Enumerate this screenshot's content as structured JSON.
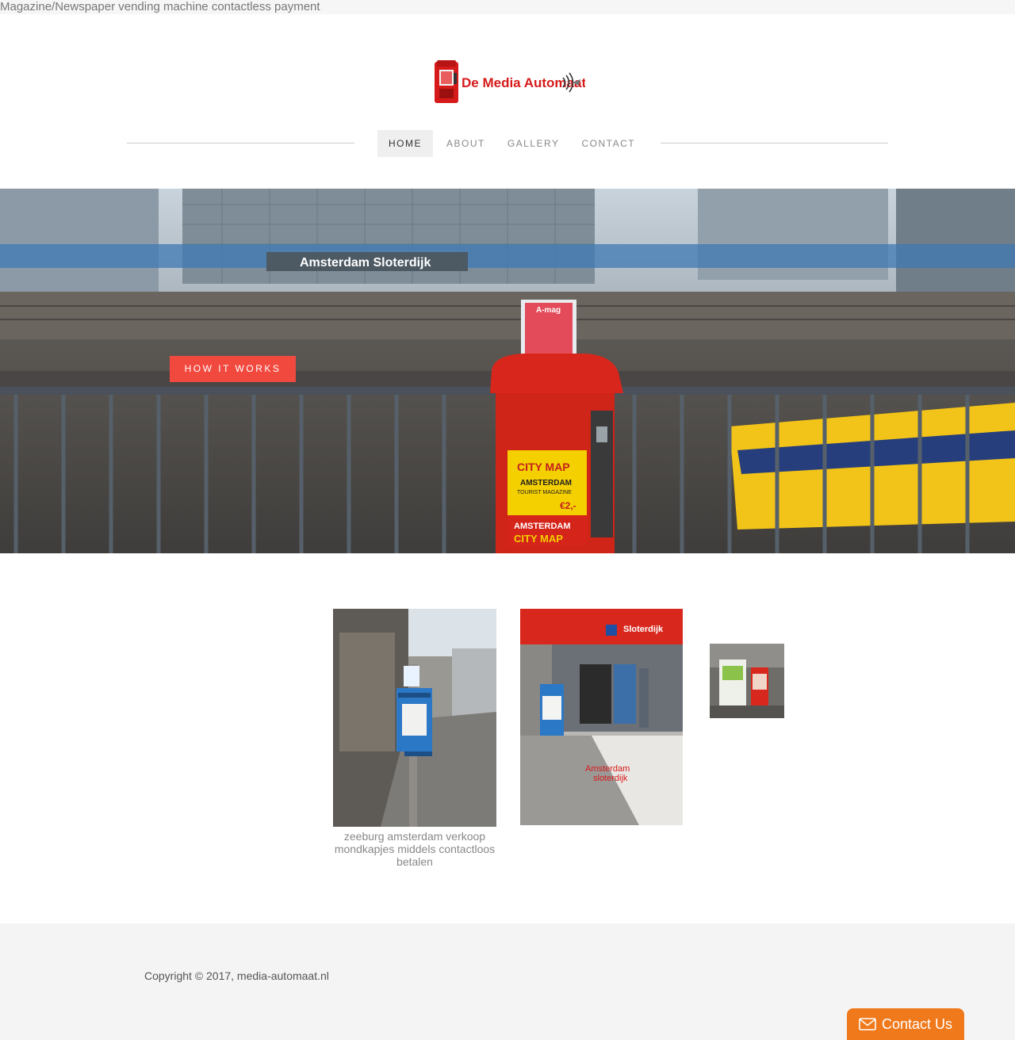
{
  "topbar": {
    "text": "Magazine/Newspaper vending machine contactless payment"
  },
  "logo": {
    "text": "De Media Automaat"
  },
  "nav": {
    "items": [
      {
        "label": "HOME",
        "active": true
      },
      {
        "label": "ABOUT",
        "active": false
      },
      {
        "label": "GALLERY",
        "active": false
      },
      {
        "label": "CONTACT",
        "active": false
      }
    ]
  },
  "hero": {
    "station_sign": "Amsterdam Sloterdijk",
    "cta_label": "HOW IT WORKS",
    "magazine_title": "A-mag",
    "machine_sign_1": "CITY MAP",
    "machine_sign_2": "AMSTERDAM",
    "machine_sign_3": "TOURIST MAGAZINE",
    "machine_price": "€2,-",
    "machine_sign_4": "AMSTERDAM",
    "machine_sign_5": "CITY MAP"
  },
  "gallery": {
    "items": [
      {
        "caption": "zeeburg amsterdam verkoop mondkapjes middels contactloos betalen"
      },
      {
        "overlay_text_1": "Amsterdam",
        "overlay_text_2": "sloterdijk",
        "station_sign": "Sloterdijk"
      },
      {}
    ]
  },
  "footer": {
    "copyright": "Copyright © 2017, media-automaat.nl"
  },
  "contact_button": {
    "label": "Contact Us",
    "icon": "envelope-icon"
  },
  "colors": {
    "accent": "#f2493f",
    "contact": "#f0791b"
  }
}
